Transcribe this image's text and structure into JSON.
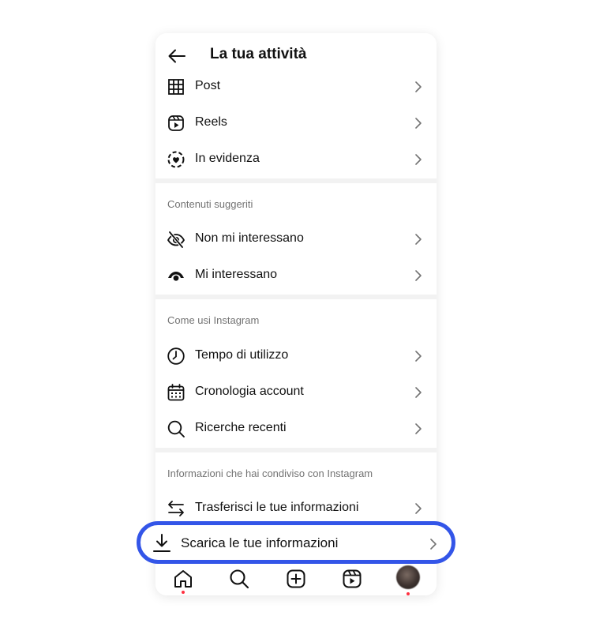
{
  "header": {
    "title": "La tua attività"
  },
  "group1": [
    {
      "label": "Post"
    },
    {
      "label": "Reels"
    },
    {
      "label": "In evidenza"
    }
  ],
  "section_suggested": {
    "title": "Contenuti suggeriti",
    "items": [
      {
        "label": "Non mi interessano"
      },
      {
        "label": "Mi interessano"
      }
    ]
  },
  "section_usage": {
    "title": "Come usi Instagram",
    "items": [
      {
        "label": "Tempo di utilizzo"
      },
      {
        "label": "Cronologia account"
      },
      {
        "label": "Ricerche recenti"
      }
    ]
  },
  "section_info": {
    "title": "Informazioni che hai condiviso con Instagram",
    "items": [
      {
        "label": "Trasferisci le tue informazioni"
      }
    ]
  },
  "highlighted": {
    "label": "Scarica le tue informazioni"
  },
  "colors": {
    "highlight_border": "#3355e8",
    "notification_dot": "#ff3040",
    "separator": "#f2f2f2",
    "secondary_text": "#737373"
  },
  "nav": {
    "icons": [
      "home-icon",
      "search-icon",
      "create-icon",
      "reels-icon",
      "profile-avatar"
    ]
  }
}
